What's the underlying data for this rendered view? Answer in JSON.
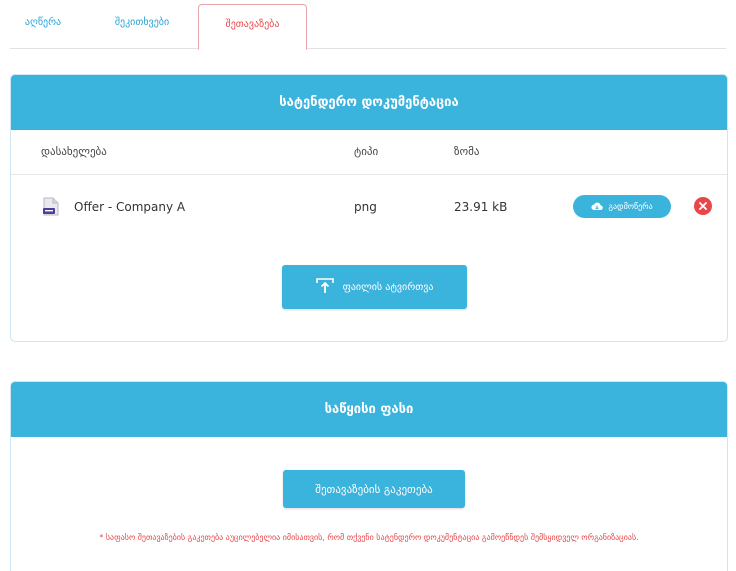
{
  "tabs": [
    {
      "label": "აღწერა",
      "active": false
    },
    {
      "label": "შეკითხვები",
      "active": false
    },
    {
      "label": "შეთავაზება",
      "active": true
    }
  ],
  "documents": {
    "title": "სატენდერო დოკუმენტაცია",
    "columns": {
      "name": "დასახელება",
      "type": "ტიპი",
      "size": "ზომა"
    },
    "rows": [
      {
        "icon": "image-file-icon",
        "name": "Offer - Company A",
        "type": "png",
        "size": "23.91 kB"
      }
    ],
    "download_label": "გადმოწერა",
    "upload_label": "ფაილის ატვირთვა"
  },
  "price": {
    "title": "საწყისი ფასი",
    "make_offer_label": "შეთავაზების გაკეთება",
    "note": "* საფასო შეთავაზების გაკეთება აუცილებელია იმისათვის, რომ თქვენი სატენდერო დოკუმენტაცია გამოეწნდეს შემსყიდველ ორგანიზაციას."
  },
  "colors": {
    "accent": "#3ab3dd",
    "danger": "#e8474a"
  }
}
